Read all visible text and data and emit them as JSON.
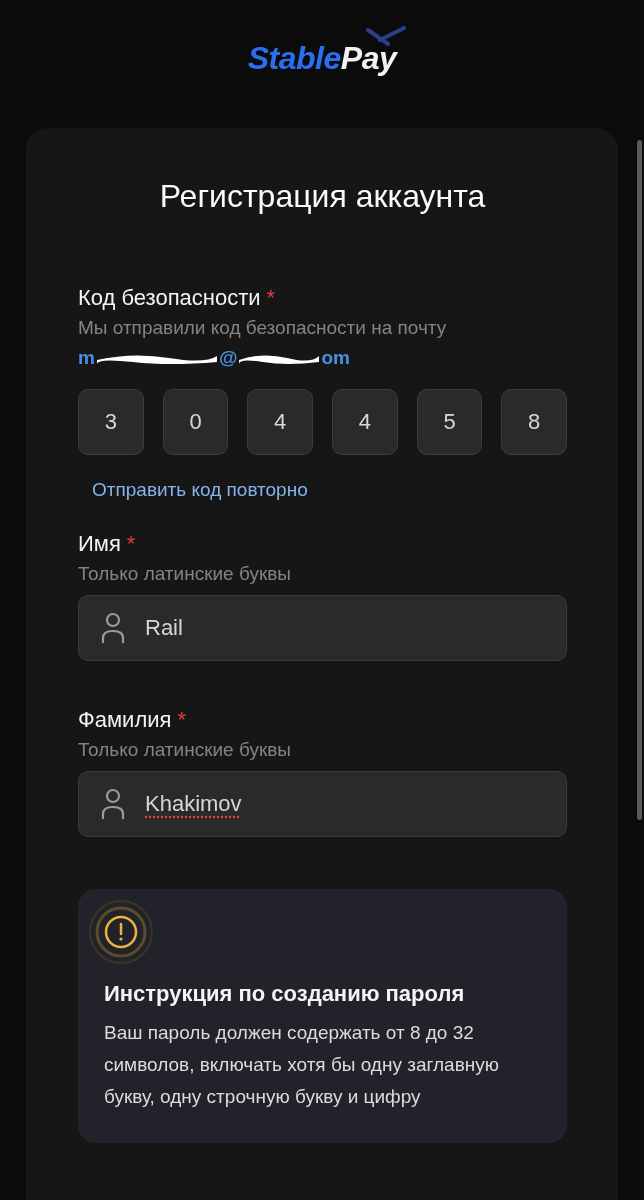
{
  "logo": {
    "part_1": "Stable",
    "part_2": "Pay"
  },
  "title": "Регистрация аккаунта",
  "security_code": {
    "label": "Код безопасности",
    "required_mark": "*",
    "hint": "Мы отправили код безопасности на почту",
    "email_visible_parts": [
      "m",
      "@",
      "om"
    ],
    "digits": [
      "3",
      "0",
      "4",
      "4",
      "5",
      "8"
    ],
    "resend_link": "Отправить код повторно"
  },
  "fields": [
    {
      "label": "Имя",
      "required_mark": "*",
      "hint": "Только латинские буквы",
      "value": "Rail",
      "spellcheck_flagged": false
    },
    {
      "label": "Фамилия",
      "required_mark": "*",
      "hint": "Только латинские буквы",
      "value": "Khakimov",
      "spellcheck_flagged": true
    }
  ],
  "password_notice": {
    "title": "Инструкция по созданию пароля",
    "text": "Ваш пароль должен содержать от 8 до 32 символов, включать хотя бы одну заглавную букву, одну строчную букву и цифру"
  }
}
